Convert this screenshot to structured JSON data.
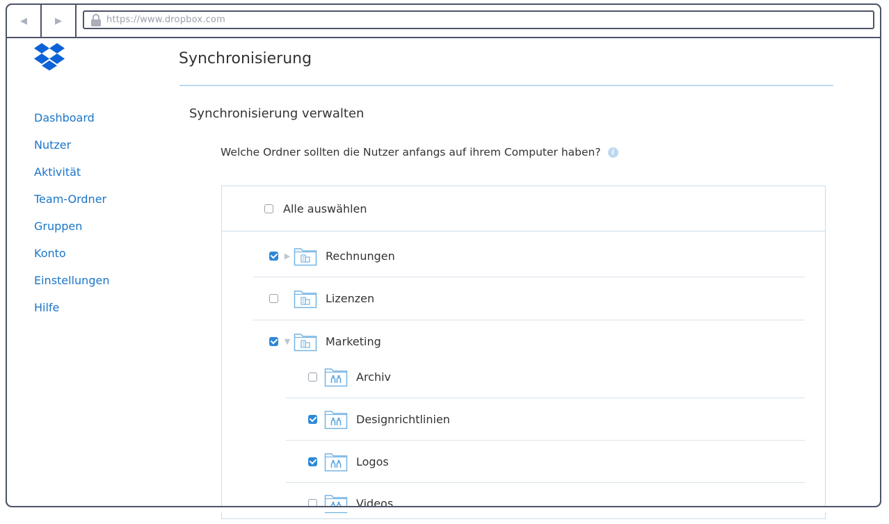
{
  "browser": {
    "url": "https://www.dropbox.com",
    "back_icon": "back-arrow-icon",
    "forward_icon": "forward-arrow-icon",
    "lock_icon": "lock-icon"
  },
  "brand": {
    "logo": "dropbox-logo",
    "color": "#0d62d8"
  },
  "sidebar": {
    "items": [
      {
        "label": "Dashboard"
      },
      {
        "label": "Nutzer"
      },
      {
        "label": "Aktivität"
      },
      {
        "label": "Team-Ordner"
      },
      {
        "label": "Gruppen"
      },
      {
        "label": "Konto"
      },
      {
        "label": "Einstellungen"
      },
      {
        "label": "Hilfe"
      }
    ]
  },
  "page": {
    "title": "Synchronisierung",
    "section_title": "Synchronisierung verwalten",
    "question": "Welche Ordner sollten die Nutzer anfangs auf ihrem Computer haben?"
  },
  "folders": {
    "select_all": {
      "label": "Alle auswählen",
      "checked": false
    },
    "items": [
      {
        "label": "Rechnungen",
        "checked": true,
        "caret": "collapsed",
        "type": "team-folder"
      },
      {
        "label": "Lizenzen",
        "checked": false,
        "caret": "none",
        "type": "team-folder"
      },
      {
        "label": "Marketing",
        "checked": true,
        "caret": "expanded",
        "type": "team-folder"
      },
      {
        "label": "Archiv",
        "checked": false,
        "type": "shared-folder"
      },
      {
        "label": "Designrichtlinien",
        "checked": true,
        "type": "shared-folder"
      },
      {
        "label": "Logos",
        "checked": true,
        "type": "shared-folder"
      },
      {
        "label": "Videos",
        "checked": false,
        "type": "shared-folder"
      }
    ]
  },
  "colors": {
    "link": "#1a75c9",
    "accent": "#2e88d8",
    "frame": "#4d5367"
  }
}
